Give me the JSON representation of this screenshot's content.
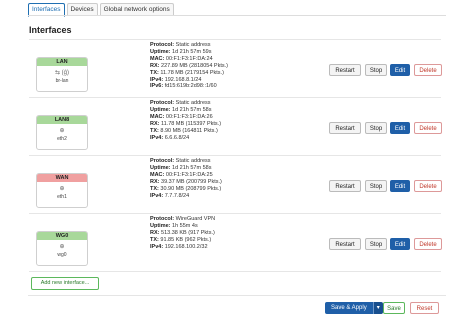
{
  "tabs": [
    {
      "label": "Interfaces"
    },
    {
      "label": "Devices"
    },
    {
      "label": "Global network options"
    }
  ],
  "page_title": "Interfaces",
  "labels": {
    "protocol": "Protocol:",
    "uptime": "Uptime:",
    "mac": "MAC:",
    "rx": "RX:",
    "tx": "TX:",
    "ipv4": "IPv4:",
    "ipv6": "IPv6:"
  },
  "interfaces": [
    {
      "name": "LAN",
      "color": "#a8d89a",
      "icons": "⇆ (ǵ)",
      "device": "br-lan",
      "protocol": "Static address",
      "uptime": "1d 21h 57m 59s",
      "mac": "00:F1:F3:1F:DA:24",
      "rx": "227.89 MB (2818054 Pkts.)",
      "tx": "11.78 MB (2179154 Pkts.)",
      "ipv4": "192.168.8.1/24",
      "ipv6": "fd15:619b:2d98::1/60"
    },
    {
      "name": "LAN8",
      "color": "#a8d89a",
      "icons": "⊕",
      "device": "eth2",
      "protocol": "Static address",
      "uptime": "1d 21h 57m 58s",
      "mac": "00:F1:F3:1F:DA:26",
      "rx": "11.78 MB (115397 Pkts.)",
      "tx": "8.90 MB (164811 Pkts.)",
      "ipv4": "6.6.6.8/24"
    },
    {
      "name": "WAN",
      "color": "#f0a0a0",
      "icons": "⊕",
      "device": "eth1",
      "protocol": "Static address",
      "uptime": "1d 21h 57m 58s",
      "mac": "00:F1:F3:1F:DA:25",
      "rx": "39.37 MB (200799 Pkts.)",
      "tx": "30.90 MB (208799 Pkts.)",
      "ipv4": "7.7.7.8/24"
    },
    {
      "name": "WG0",
      "color": "#a8d89a",
      "icons": "⊕",
      "device": "wg0",
      "protocol": "WireGuard VPN",
      "uptime": "1h 55m 4s",
      "rx": "513.38 KB (917 Pkts.)",
      "tx": "91.85 KB (962 Pkts.)",
      "ipv4": "192.168.100.2/32"
    }
  ],
  "buttons": {
    "restart": "Restart",
    "stop": "Stop",
    "edit": "Edit",
    "delete": "Delete",
    "add_interface": "Add new interface...",
    "save_apply": "Save & Apply",
    "save_apply_dropdown": "▾",
    "save": "Save",
    "reset": "Reset"
  }
}
